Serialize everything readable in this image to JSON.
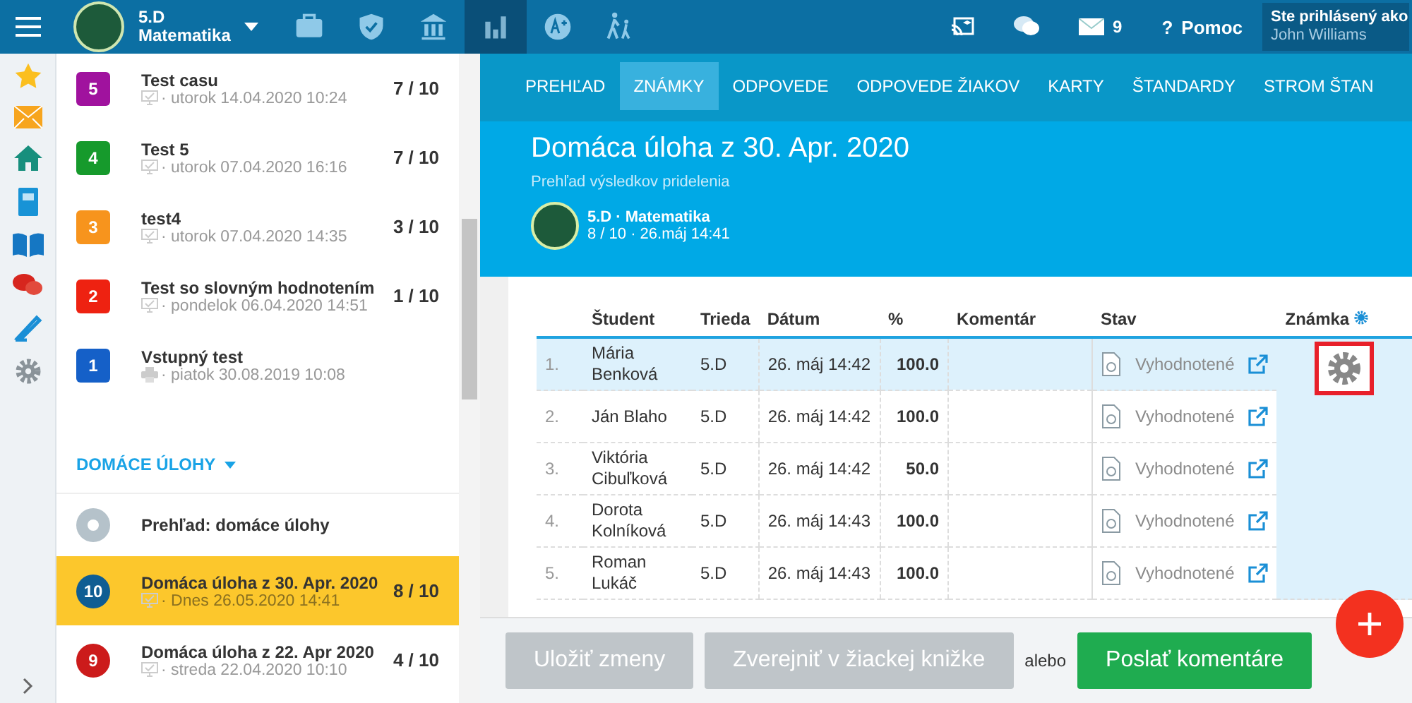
{
  "topbar": {
    "class_name": "5.D",
    "subject": "Matematika",
    "nav": [
      {
        "kind": "briefcase",
        "selected": false
      },
      {
        "kind": "shield",
        "selected": false
      },
      {
        "kind": "building",
        "selected": false
      },
      {
        "kind": "chart",
        "selected": true
      },
      {
        "kind": "grade",
        "selected": false
      },
      {
        "kind": "walkers",
        "selected": false
      }
    ],
    "messages_count": "9",
    "help_icon": "?",
    "help": "Pomoc",
    "user_label": "Ste prihlásený ako",
    "user_name": "John Williams"
  },
  "tests": [
    {
      "number": "5",
      "color": "#a0129e",
      "title": "Test casu",
      "kind": "monitor",
      "date": "· utorok 14.04.2020 10:24",
      "score": "7 / 10"
    },
    {
      "number": "4",
      "color": "#169a2c",
      "title": "Test 5",
      "kind": "monitor",
      "date": "· utorok 07.04.2020 16:16",
      "score": "7 / 10"
    },
    {
      "number": "3",
      "color": "#f7941d",
      "title": "test4",
      "kind": "monitor",
      "date": "· utorok 07.04.2020 14:35",
      "score": "3 / 10"
    },
    {
      "number": "2",
      "color": "#ee2211",
      "title": "Test so slovným hodnotením",
      "kind": "monitor",
      "date": "· pondelok 06.04.2020 14:51",
      "score": "1 / 10"
    },
    {
      "number": "1",
      "color": "#1560c8",
      "title": "Vstupný test",
      "kind": "printer",
      "date": "· piatok 30.08.2019 10:08"
    }
  ],
  "homework_section": "DOMÁCE ÚLOHY",
  "homework_overview": "Prehľad: domáce úlohy",
  "homework": [
    {
      "number": "10",
      "color": "#0f5d93",
      "title": "Domáca úloha z 30. Apr. 2020",
      "date": "· Dnes 26.05.2020 14:41",
      "score": "8 / 10",
      "selected": true
    },
    {
      "number": "9",
      "color": "#cc1b1b",
      "title": "Domáca úloha z 22. Apr 2020",
      "date": "· streda 22.04.2020 10:10",
      "score": "4 / 10",
      "selected": false
    }
  ],
  "tabs": [
    {
      "label": "PREHĽAD",
      "selected": false
    },
    {
      "label": "ZNÁMKY",
      "selected": true
    },
    {
      "label": "ODPOVEDE",
      "selected": false
    },
    {
      "label": "ODPOVEDE ŽIAKOV",
      "selected": false
    },
    {
      "label": "KARTY",
      "selected": false
    },
    {
      "label": "ŠTANDARDY",
      "selected": false
    },
    {
      "label": "STROM ŠTAN",
      "selected": false
    }
  ],
  "assignment": {
    "title": "Domáca úloha z 30. Apr. 2020",
    "subtitle": "Prehľad výsledkov pridelenia",
    "class_line": "5.D · Matematika",
    "meta": "8 / 10 · 26.máj 14:41"
  },
  "table": {
    "columns": [
      "Študent",
      "Trieda",
      "Dátum",
      "%",
      "Komentár",
      "Stav",
      "Známka"
    ],
    "rows": [
      {
        "number": "1.",
        "student": "Mária Benková",
        "class": "5.D",
        "date": "26. máj 14:42",
        "percent": "100.0",
        "status": "Vyhodnotené",
        "selected": true
      },
      {
        "number": "2.",
        "student": "Ján Blaho",
        "class": "5.D",
        "date": "26. máj 14:42",
        "percent": "100.0",
        "status": "Vyhodnotené",
        "selected": false
      },
      {
        "number": "3.",
        "student": "Viktória Cibuľková",
        "class": "5.D",
        "date": "26. máj 14:42",
        "percent": "50.0",
        "status": "Vyhodnotené",
        "selected": false
      },
      {
        "number": "4.",
        "student": "Dorota Kolníková",
        "class": "5.D",
        "date": "26. máj 14:43",
        "percent": "100.0",
        "status": "Vyhodnotené",
        "selected": false
      },
      {
        "number": "5.",
        "student": "Roman Lukáč",
        "class": "5.D",
        "date": "26. máj 14:43",
        "percent": "100.0",
        "status": "Vyhodnotené",
        "selected": false
      }
    ]
  },
  "actions": {
    "save": {
      "label": "Uložiť zmeny",
      "disabled": true
    },
    "publish": {
      "label": "Zverejniť v žiackej knižke",
      "disabled": true
    },
    "or": "alebo",
    "send": {
      "label": "Poslať komentáre",
      "disabled": false
    }
  }
}
